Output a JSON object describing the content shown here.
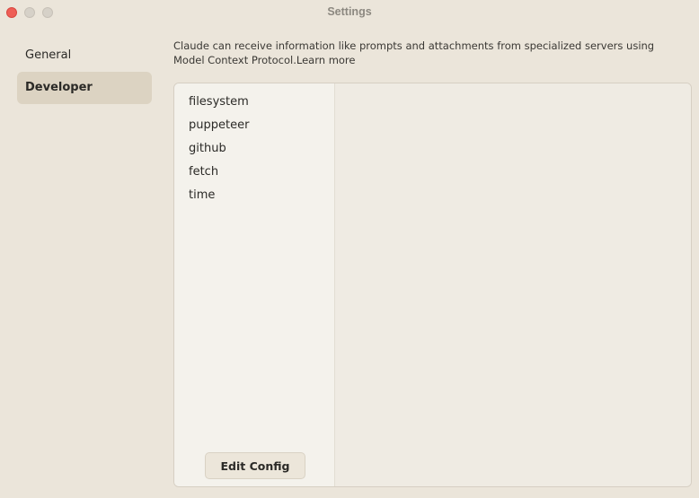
{
  "window": {
    "title": "Settings"
  },
  "sidebar": {
    "items": [
      {
        "label": "General",
        "active": false
      },
      {
        "label": "Developer",
        "active": true
      }
    ]
  },
  "main": {
    "description_text": "Claude can receive information like prompts and attachments from specialized servers using Model Context Protocol.",
    "learn_more_label": "Learn more",
    "servers": [
      {
        "label": "filesystem"
      },
      {
        "label": "puppeteer"
      },
      {
        "label": "github"
      },
      {
        "label": "fetch"
      },
      {
        "label": "time"
      }
    ],
    "edit_config_label": "Edit Config"
  },
  "colors": {
    "background": "#ebe5da",
    "active_nav": "#dcd3c2",
    "list_background": "#f4f2ec",
    "close_button": "#ee5e56"
  }
}
